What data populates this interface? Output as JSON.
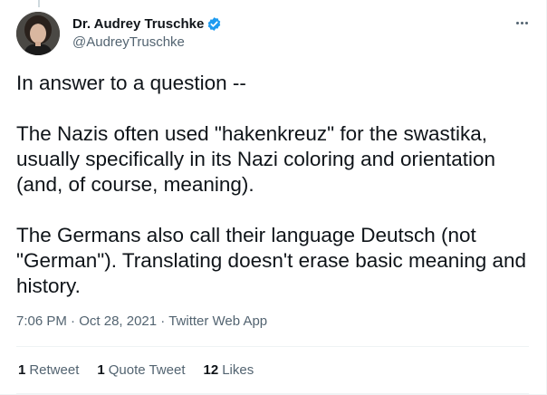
{
  "author": {
    "display_name": "Dr. Audrey Truschke",
    "handle": "@AudreyTruschke",
    "verified": true
  },
  "tweet": {
    "paragraphs": [
      "In answer to a question --",
      "The Nazis often used \"hakenkreuz\" for the swastika, usually specifically in its Nazi coloring and orientation (and, of course, meaning).",
      "The Germans also call their language Deutsch (not \"German\"). Translating doesn't erase basic meaning and history."
    ],
    "time": "7:06 PM",
    "date": "Oct 28, 2021",
    "separator": "·",
    "source": "Twitter Web App"
  },
  "stats": {
    "retweets": {
      "count": "1",
      "label": "Retweet"
    },
    "quote_tweets": {
      "count": "1",
      "label": "Quote Tweet"
    },
    "likes": {
      "count": "12",
      "label": "Likes"
    }
  },
  "colors": {
    "verified_badge": "#1d9bf0",
    "secondary_text": "#536471",
    "primary_text": "#0f1419",
    "divider": "#eff3f4"
  },
  "icons": {
    "verified": "verified-badge-icon",
    "more": "more-options-icon"
  }
}
